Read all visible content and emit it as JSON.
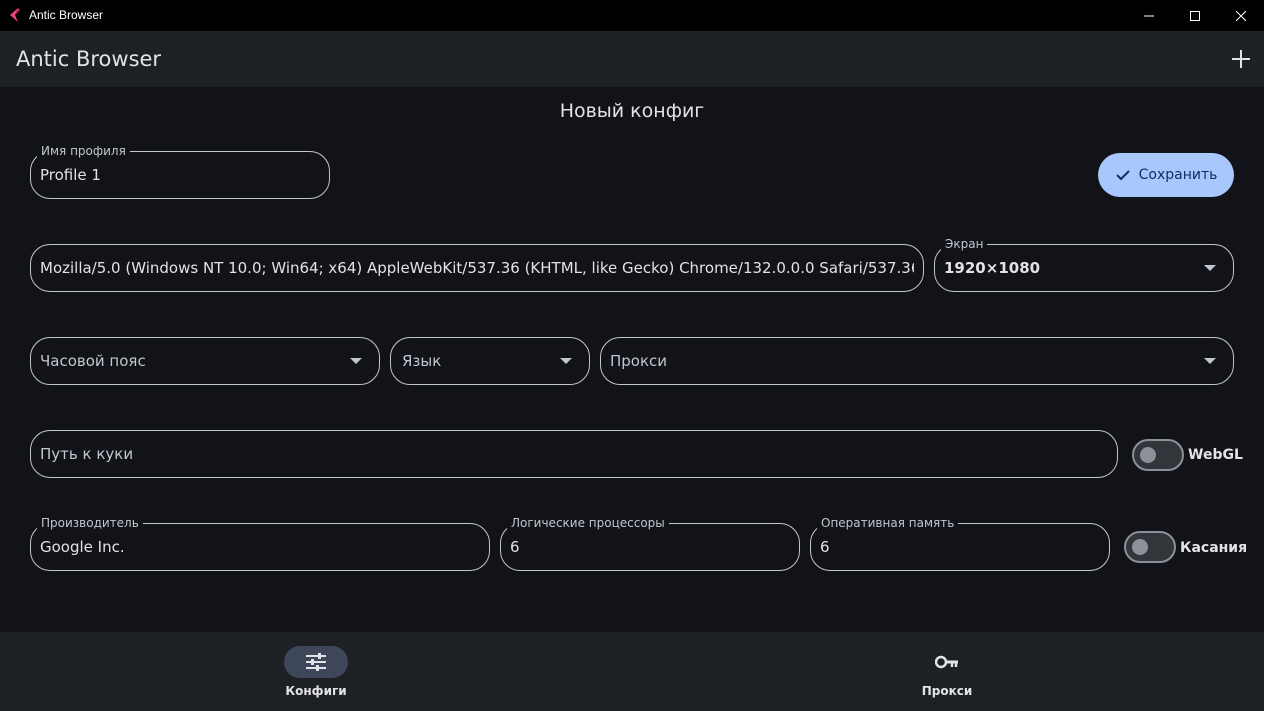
{
  "window": {
    "title": "Antic Browser",
    "controls": [
      "minimize-icon",
      "maximize-icon",
      "close-icon"
    ]
  },
  "appbar": {
    "title": "Antic Browser",
    "add_icon": "plus-icon"
  },
  "form": {
    "title": "Новый конфиг",
    "profile_name": {
      "label": "Имя профиля",
      "value": "Profile 1"
    },
    "save_button": {
      "label": "Сохранить",
      "icon": "check-icon"
    },
    "user_agent": {
      "value": "Mozilla/5.0 (Windows NT 10.0; Win64; x64) AppleWebKit/537.36 (KHTML, like Gecko) Chrome/132.0.0.0 Safari/537.36"
    },
    "screen": {
      "label": "Экран",
      "value": "1920×1080"
    },
    "timezone": {
      "placeholder": "Часовой пояс"
    },
    "language": {
      "placeholder": "Язык"
    },
    "proxy": {
      "placeholder": "Прокси"
    },
    "cookies_path": {
      "placeholder": "Путь к куки"
    },
    "webgl": {
      "label": "WebGL",
      "enabled": false
    },
    "vendor": {
      "label": "Производитель",
      "value": "Google Inc."
    },
    "cpu": {
      "label": "Логические процессоры",
      "value": "6"
    },
    "memory": {
      "label": "Оперативная память",
      "value": "6"
    },
    "touch": {
      "label": "Касания",
      "enabled": false
    }
  },
  "bottom_nav": {
    "items": [
      {
        "label": "Конфиги",
        "icon": "sliders-icon",
        "active": true
      },
      {
        "label": "Прокси",
        "icon": "key-icon",
        "active": false
      }
    ]
  },
  "colors": {
    "background": "#111318",
    "surface": "#1d2024",
    "accent": "#a8c8fb",
    "outline": "#c4c6cf"
  }
}
